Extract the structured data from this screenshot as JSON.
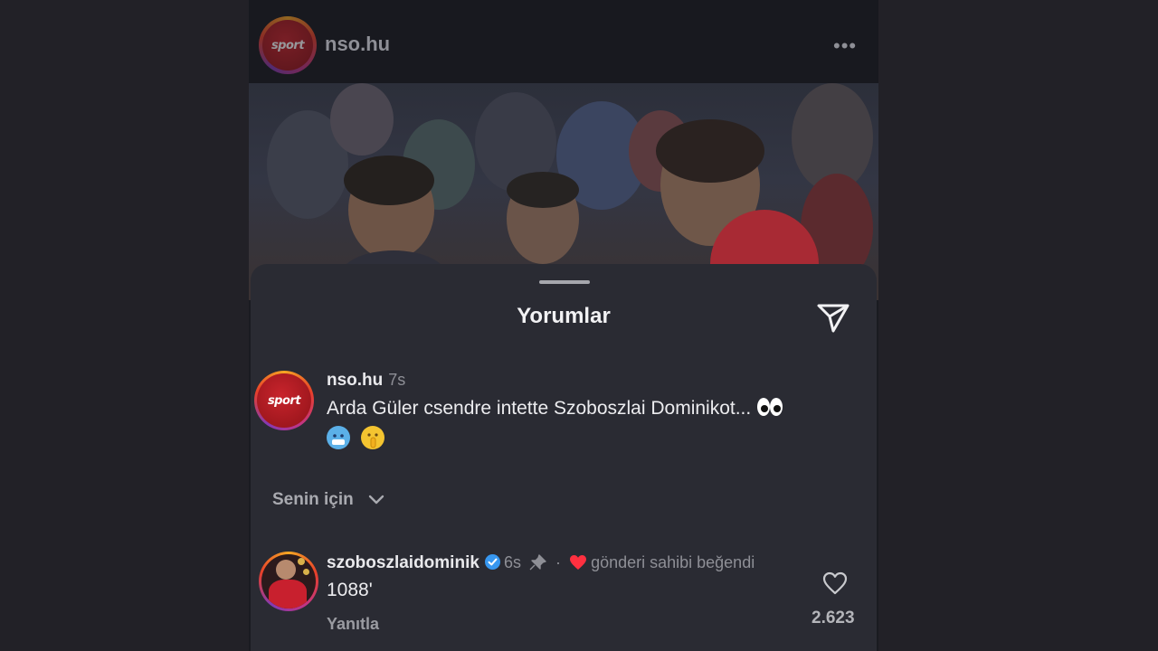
{
  "post": {
    "username": "nso.hu",
    "avatar_logo_text": "sport",
    "more_icon": "more-horizontal-icon"
  },
  "comments_sheet": {
    "title": "Yorumlar",
    "send_icon": "send-icon",
    "caption": {
      "username": "nso.hu",
      "time": "7s",
      "text": "Arda Güler csendre intette Szoboszlai Dominikot...",
      "emojis": [
        "eyes",
        "cold-face",
        "shushing-face"
      ]
    },
    "filter_label": "Senin için",
    "comments": [
      {
        "username": "szoboszlaidominik",
        "verified": true,
        "time": "6s",
        "pinned": true,
        "separator": "·",
        "liked_by_author_text": "gönderi sahibi beğendi",
        "text": "1088'",
        "reply_label": "Yanıtla",
        "like_count": "2.623"
      }
    ]
  },
  "colors": {
    "background": "#222127",
    "sheet": "#2a2b33",
    "verified_blue": "#3797f0",
    "heart_red": "#ff3040"
  }
}
